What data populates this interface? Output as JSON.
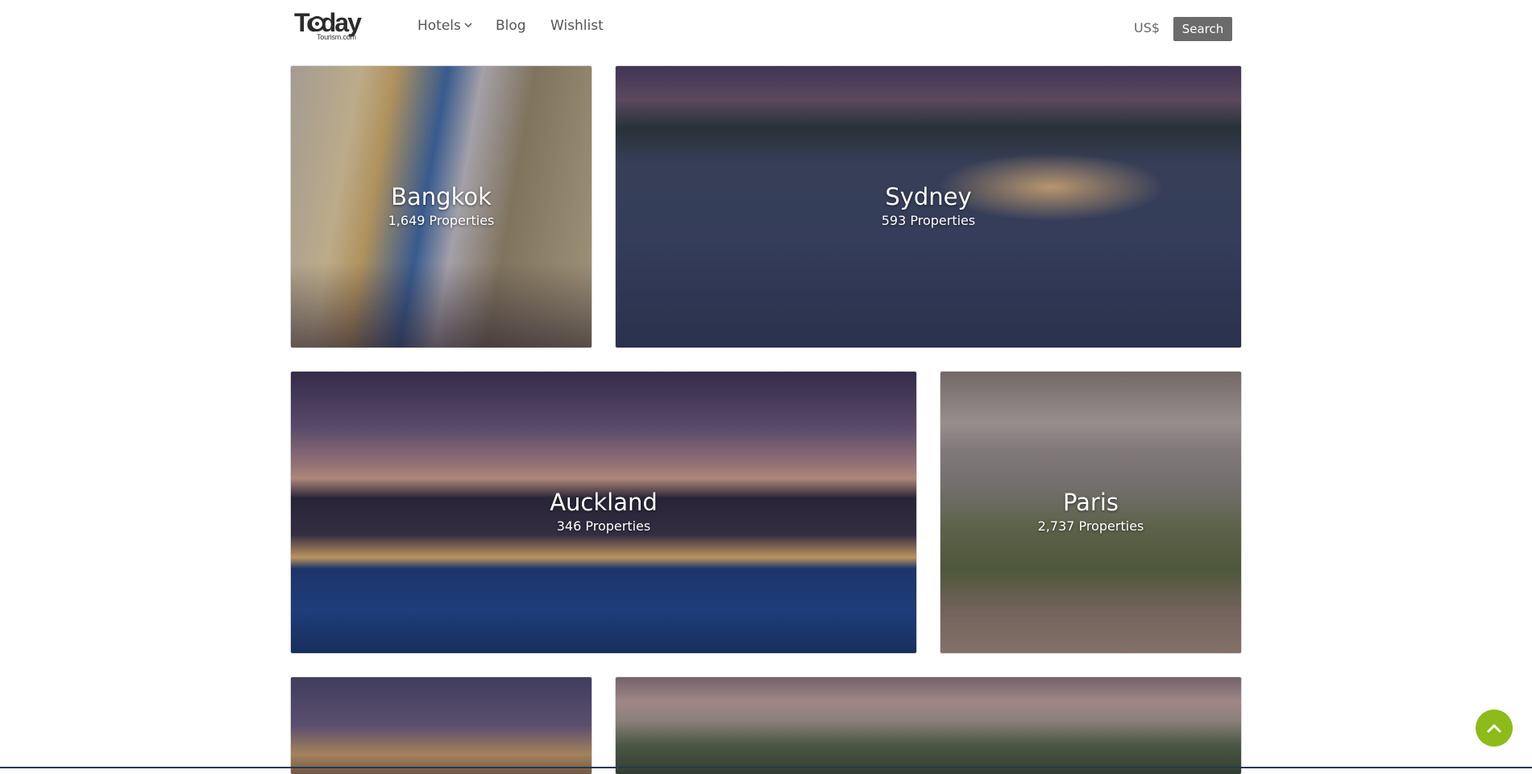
{
  "header": {
    "logo": {
      "word": "Today",
      "sub": "Tourism.com"
    },
    "nav": {
      "hotels": "Hotels",
      "blog": "Blog",
      "wishlist": "Wishlist"
    },
    "currency": "US$",
    "search_label": "Search"
  },
  "destinations": [
    {
      "city": "Bangkok",
      "properties": "1,649 Properties"
    },
    {
      "city": "Sydney",
      "properties": "593 Properties"
    },
    {
      "city": "Auckland",
      "properties": "346 Properties"
    },
    {
      "city": "Paris",
      "properties": "2,737 Properties"
    }
  ],
  "icons": {
    "hotels_dropdown": "chevron-down-icon",
    "scroll_top": "chevron-up-icon"
  },
  "colors": {
    "search_button": "#6b6b6b",
    "scroll_top_button": "#8dbb1a"
  }
}
